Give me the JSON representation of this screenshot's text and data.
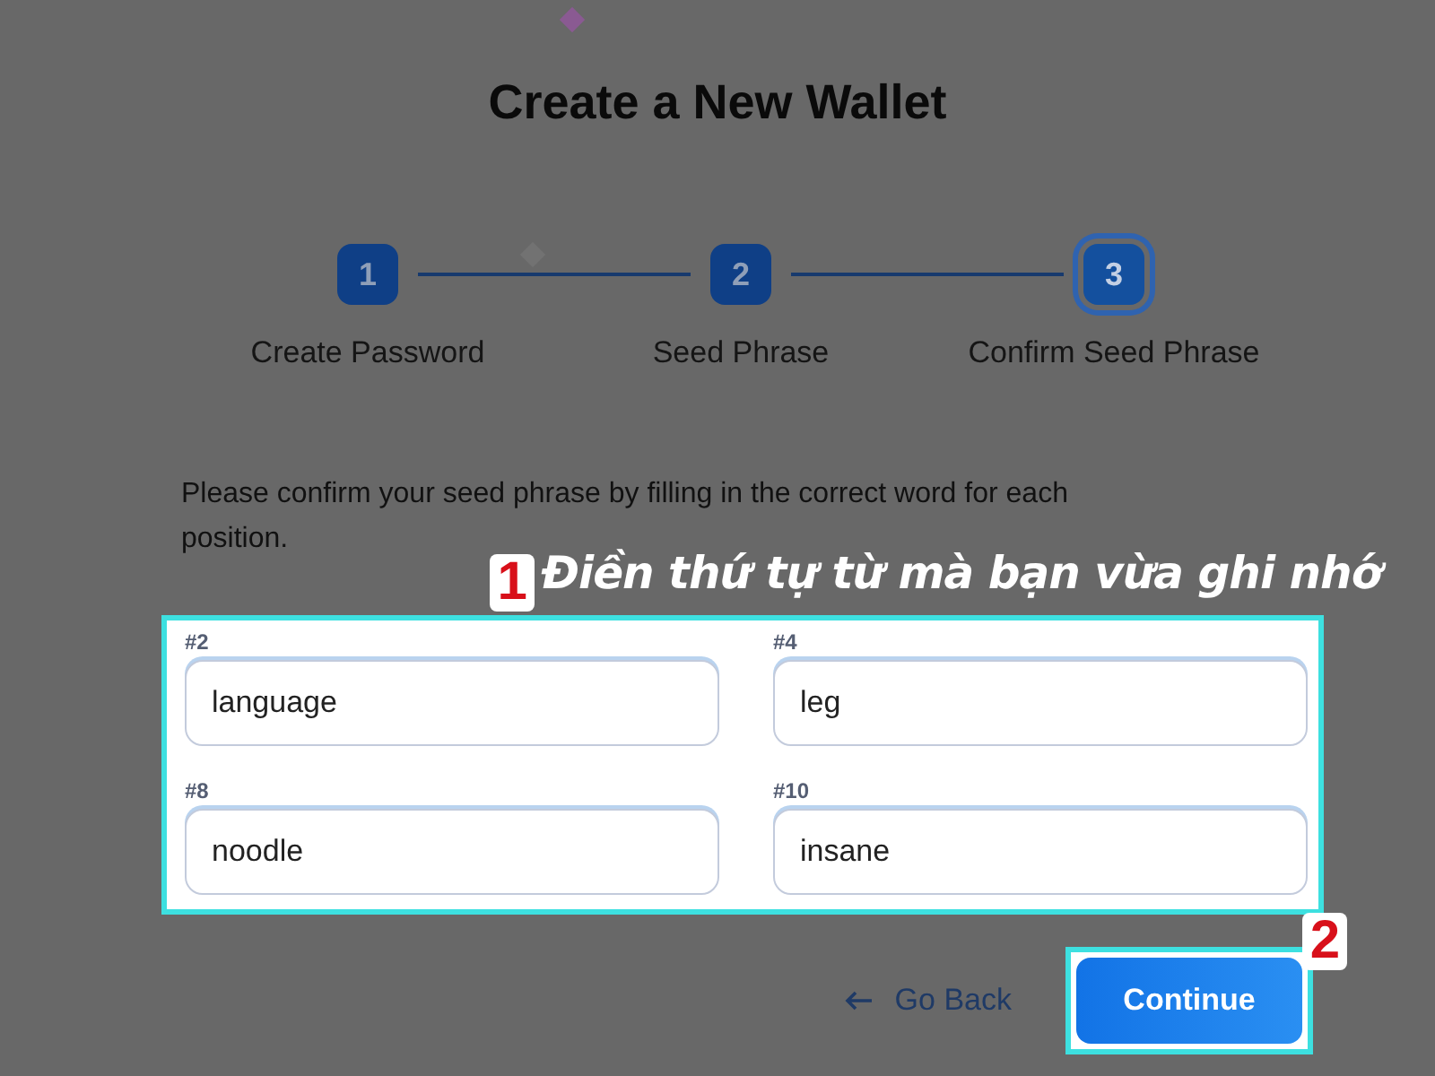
{
  "title": "Create a New Wallet",
  "steps": [
    {
      "number": "1",
      "label": "Create Password",
      "selected": false
    },
    {
      "number": "2",
      "label": "Seed Phrase",
      "selected": false
    },
    {
      "number": "3",
      "label": "Confirm Seed Phrase",
      "selected": true
    }
  ],
  "instruction": "Please confirm your seed phrase by filling in the correct word for each position.",
  "fields": [
    {
      "label": "#2",
      "value": "language"
    },
    {
      "label": "#4",
      "value": "leg"
    },
    {
      "label": "#8",
      "value": "noodle"
    },
    {
      "label": "#10",
      "value": "insane"
    }
  ],
  "callouts": [
    {
      "number": "1",
      "text": "Điền thứ tự từ mà bạn vừa ghi nhớ"
    },
    {
      "number": "2"
    }
  ],
  "back_button": "Go Back",
  "continue_button": "Continue"
}
